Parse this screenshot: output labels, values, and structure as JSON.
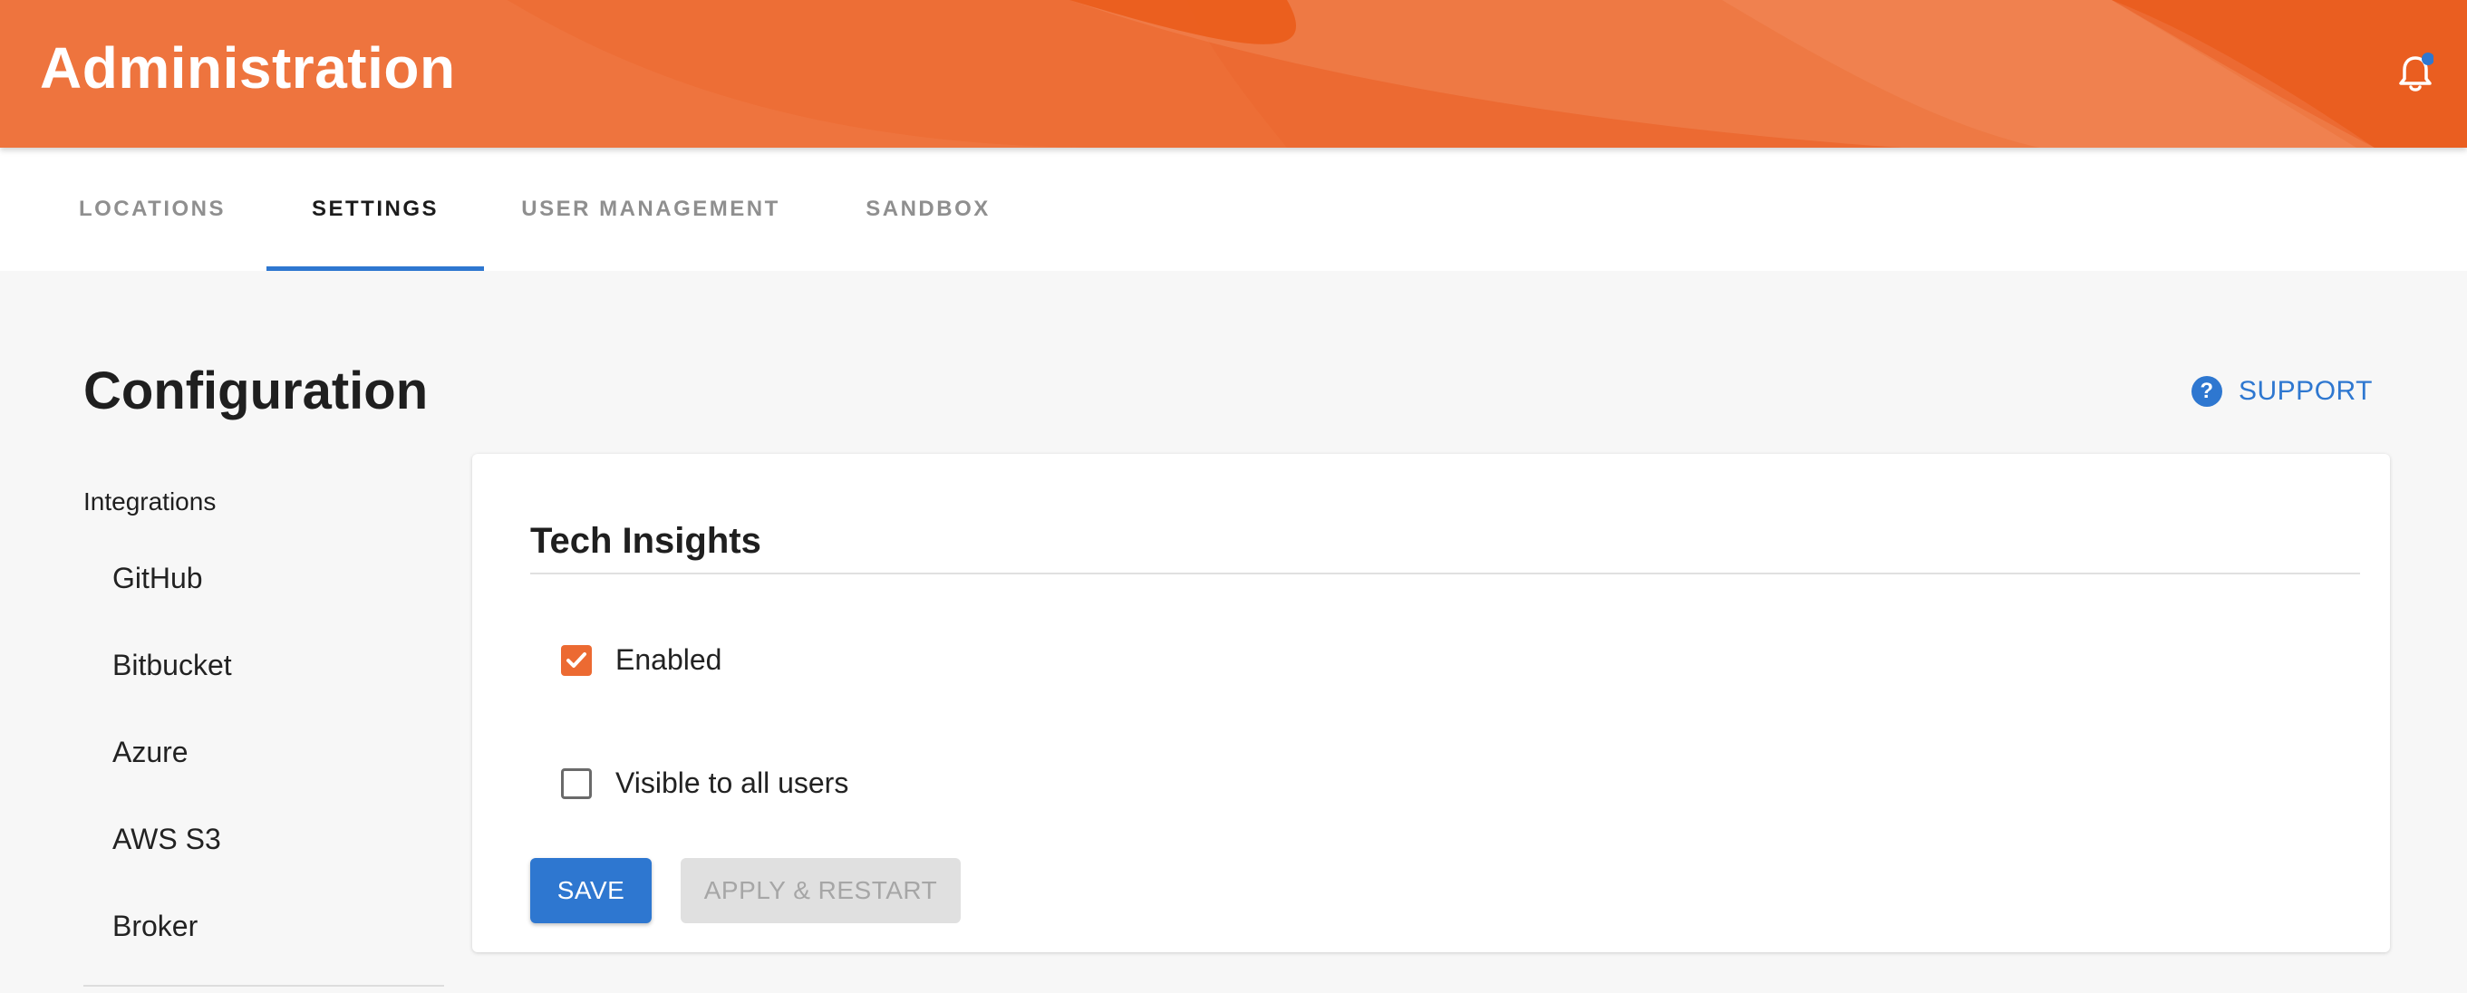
{
  "header": {
    "title": "Administration",
    "accent_color": "#ec6a32",
    "notification_icon": "bell-icon",
    "notification_dot_color": "#2e77d0"
  },
  "tabs": [
    {
      "label": "LOCATIONS",
      "active": false
    },
    {
      "label": "SETTINGS",
      "active": true
    },
    {
      "label": "USER MANAGEMENT",
      "active": false
    },
    {
      "label": "SANDBOX",
      "active": false
    }
  ],
  "page": {
    "title": "Configuration",
    "support_label": "SUPPORT",
    "support_icon": "help-circle-icon"
  },
  "sidebar": {
    "heading": "Integrations",
    "items": [
      "GitHub",
      "Bitbucket",
      "Azure",
      "AWS S3",
      "Broker"
    ]
  },
  "card": {
    "title": "Tech Insights",
    "options": [
      {
        "label": "Enabled",
        "checked": true
      },
      {
        "label": "Visible to all users",
        "checked": false
      }
    ],
    "save_label": "SAVE",
    "apply_label": "APPLY & RESTART",
    "apply_disabled": true
  },
  "colors": {
    "primary": "#2e77d0",
    "checkbox_checked": "#ec6a32",
    "page_background": "#f7f7f7"
  }
}
